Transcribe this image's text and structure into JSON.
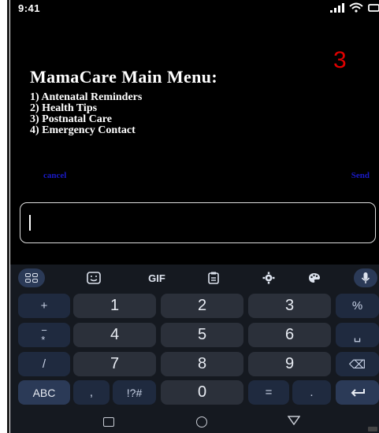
{
  "status_bar": {
    "time": "9:41"
  },
  "step_number": "3",
  "menu": {
    "title": "MamaCare Main Menu:",
    "items": [
      "1) Antenatal Reminders",
      "2) Health Tips",
      "3) Postnatal Care",
      "4) Emergency Contact"
    ]
  },
  "dialog": {
    "cancel_label": "cancel",
    "send_label": "Send",
    "input_value": ""
  },
  "keyboard": {
    "toolbar": {
      "gif_label": "GIF"
    },
    "rows": [
      {
        "left": "+",
        "keys": [
          "1",
          "2",
          "3"
        ],
        "right": "%"
      },
      {
        "left": "−\n*",
        "keys": [
          "4",
          "5",
          "6"
        ],
        "right": "␣"
      },
      {
        "left": "/",
        "keys": [
          "7",
          "8",
          "9"
        ],
        "right": "⌫"
      }
    ],
    "bottom": {
      "abc": "ABC",
      "comma": ",",
      "symbols": "!?#",
      "zero": "0",
      "equals": "=",
      "period": "."
    },
    "accent_color": "#2b3a57"
  }
}
